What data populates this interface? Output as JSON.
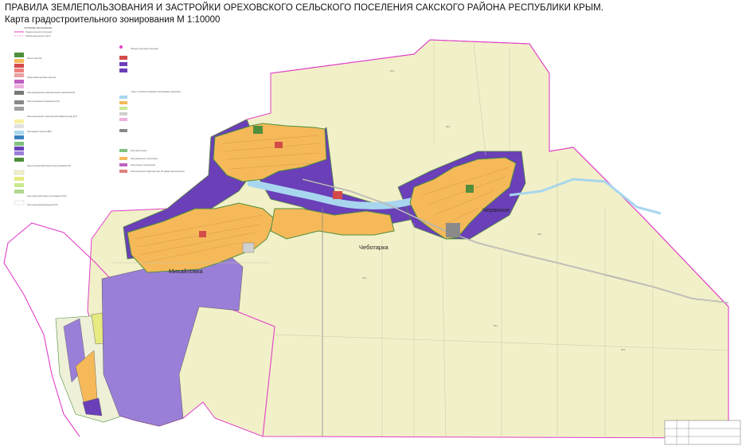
{
  "title": {
    "line1": "ПРАВИЛА ЗЕМЛЕПОЛЬЗОВАНИЯ И ЗАСТРОЙКИ ОРЕХОВСКОГО СЕЛЬСКОГО ПОСЕЛЕНИЯ  САКСКОГО РАЙОНА РЕСПУБЛИКИ КРЫМ.",
    "line2": "Карта градостроительного зонирования М 1:10000"
  },
  "places": {
    "mikhailovka": "Михайловка",
    "chebotarka": "Чеботарка",
    "chervonoe": "Червоное"
  },
  "legend": {
    "heading": "УСЛОВНЫЕ ОБОЗНАЧЕНИЯ",
    "entries": [
      "Граница сельского поселения",
      "Граница населенного пункта",
      "Жилые зоны (Ж)",
      "Общественно-деловые зоны (О)",
      "Зона рекреационно-оздоровительного назначения (Р)",
      "Зона специального назначения (СП)",
      "Зоны инженерной и транспортной инфраструктуры (И,Т)",
      "Зона водных объектов (ВО)",
      "Зоны сельскохозяйственного использования (СХ)",
      "Зона территорий общего пользования (ТОП)",
      "Зона территорий размещения (ТР)"
    ]
  },
  "legend2": {
    "heading": "Объекты культурного наследия",
    "entries": [
      "Зоны с особыми условиями использования территории",
      "Зона подтопления",
      "Зона умеренного подтопления",
      "Зона сильного подтопления",
      "Зона затопления территории при 1% уровне обеспеченности"
    ]
  },
  "zone_codes": {
    "agri": "СХ-1",
    "resid": "Ж-1"
  },
  "colors": {
    "boundary": "#e040c8",
    "residential": "#f5b95a",
    "agricultural": "#f2f0c8",
    "recreation": "#6a3fb8",
    "recreation_light": "#9a7fd8",
    "water": "#a8d6ee",
    "green": "#4f8f3c",
    "road": "#8a8a8a",
    "public": "#d44a4a"
  }
}
